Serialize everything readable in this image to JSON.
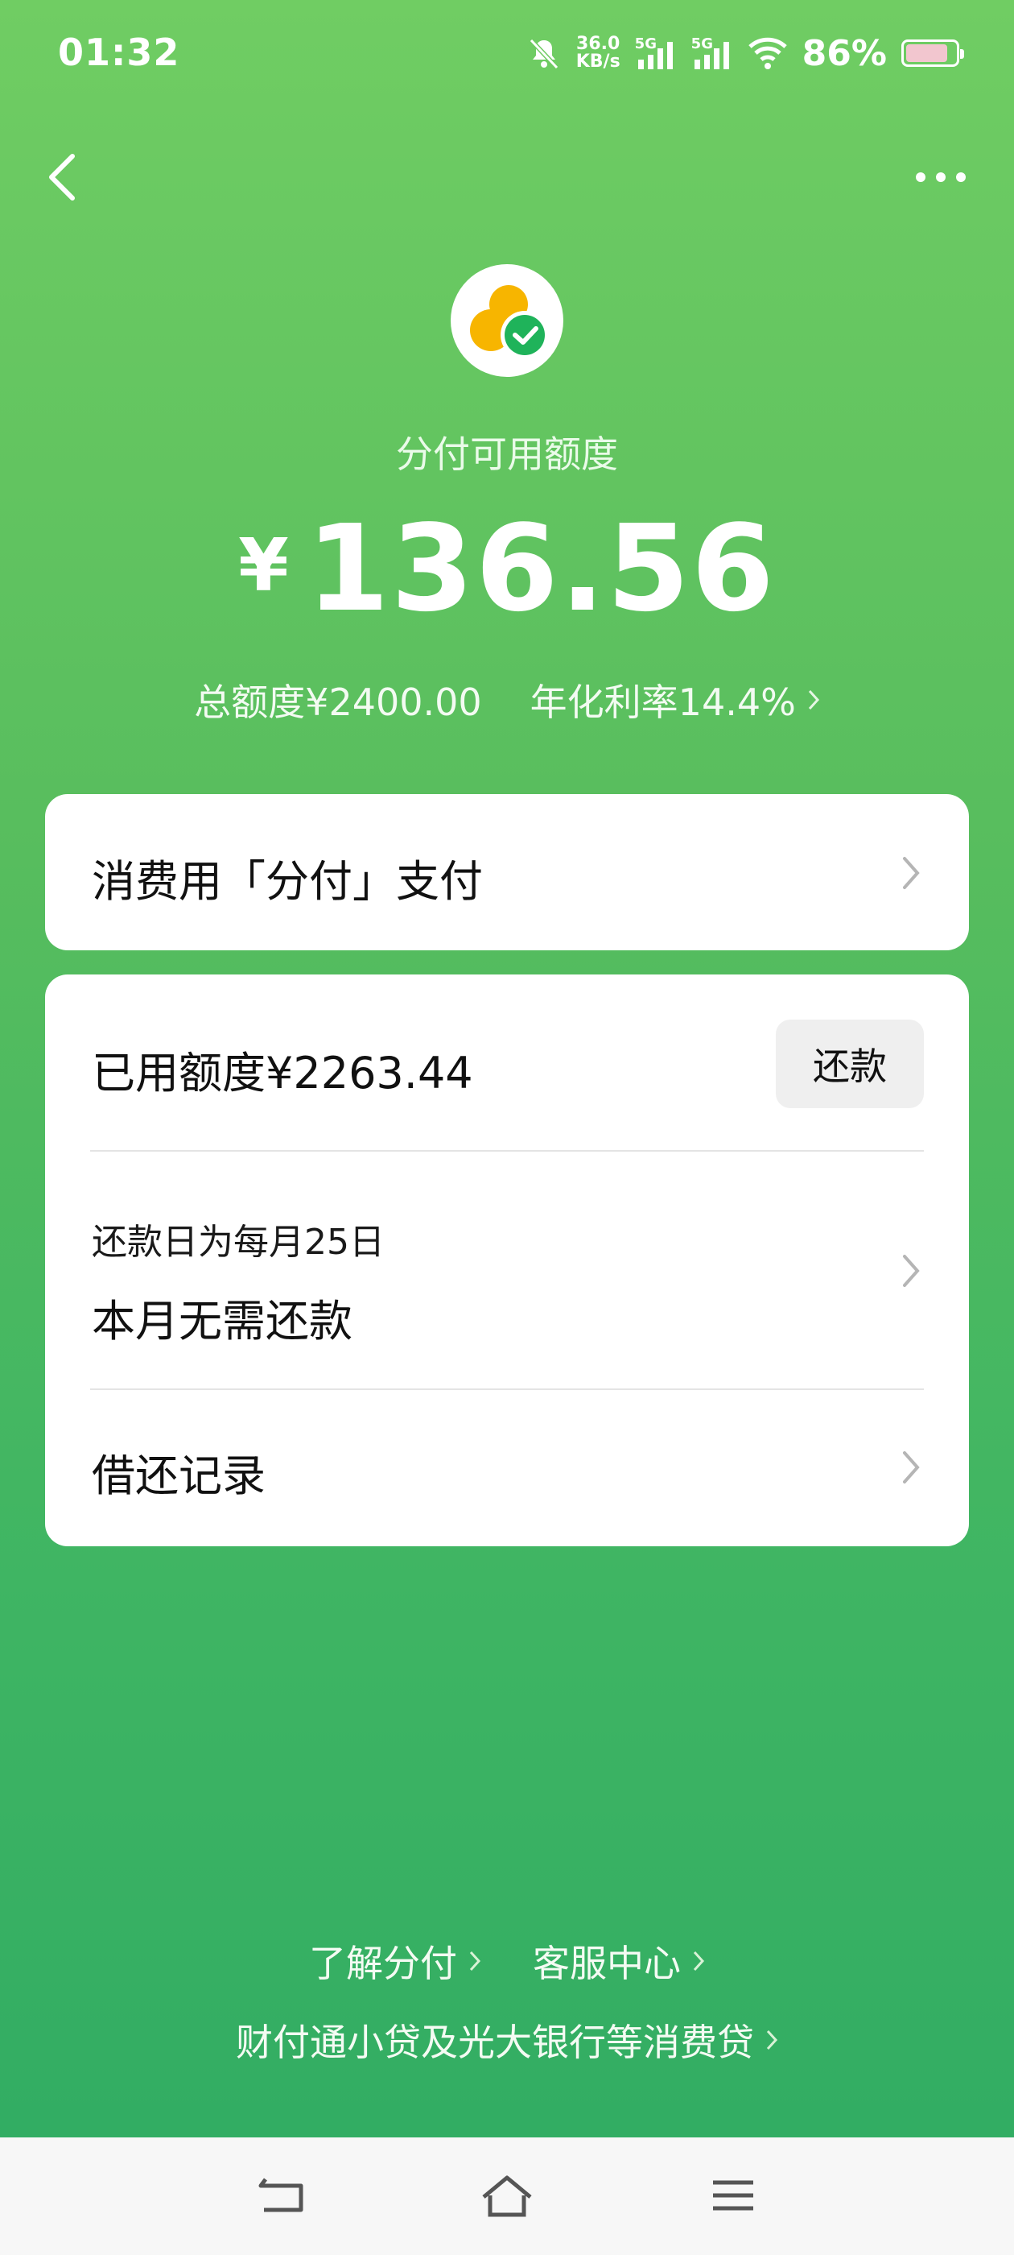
{
  "status_bar": {
    "time": "01:32",
    "net_speed_value": "36.0",
    "net_speed_unit": "KB/s",
    "signal_1": "5G",
    "signal_2": "5G",
    "battery_percent": "86%",
    "battery_level": 0.86,
    "icons": [
      "mute-bell-icon",
      "signal-icon",
      "signal-icon",
      "wifi-icon",
      "battery-icon"
    ]
  },
  "header": {
    "back_icon": "chevron-left-icon",
    "more_icon": "more-dots-icon"
  },
  "summary": {
    "title": "分付可用额度",
    "currency": "¥",
    "available": "136.56",
    "total_quota": "总额度¥2400.00",
    "annual_rate": "年化利率14.4%"
  },
  "pay_card": {
    "label": "消费用「分付」支付"
  },
  "repay_card": {
    "used_quota": "已用额度¥2263.44",
    "repay_button": "还款",
    "due_day": "还款日为每月25日",
    "due_status": "本月无需还款",
    "records": "借还记录"
  },
  "footer": {
    "learn": "了解分付",
    "service": "客服中心",
    "note": "财付通小贷及光大银行等消费贷"
  },
  "colors": {
    "gradient_top": "#70cd63",
    "gradient_bottom": "#2fab63",
    "logo_yellow": "#f7b500",
    "logo_green": "#1fb35a"
  },
  "navbar": {
    "icons": [
      "back-nav-icon",
      "home-nav-icon",
      "menu-nav-icon"
    ]
  }
}
